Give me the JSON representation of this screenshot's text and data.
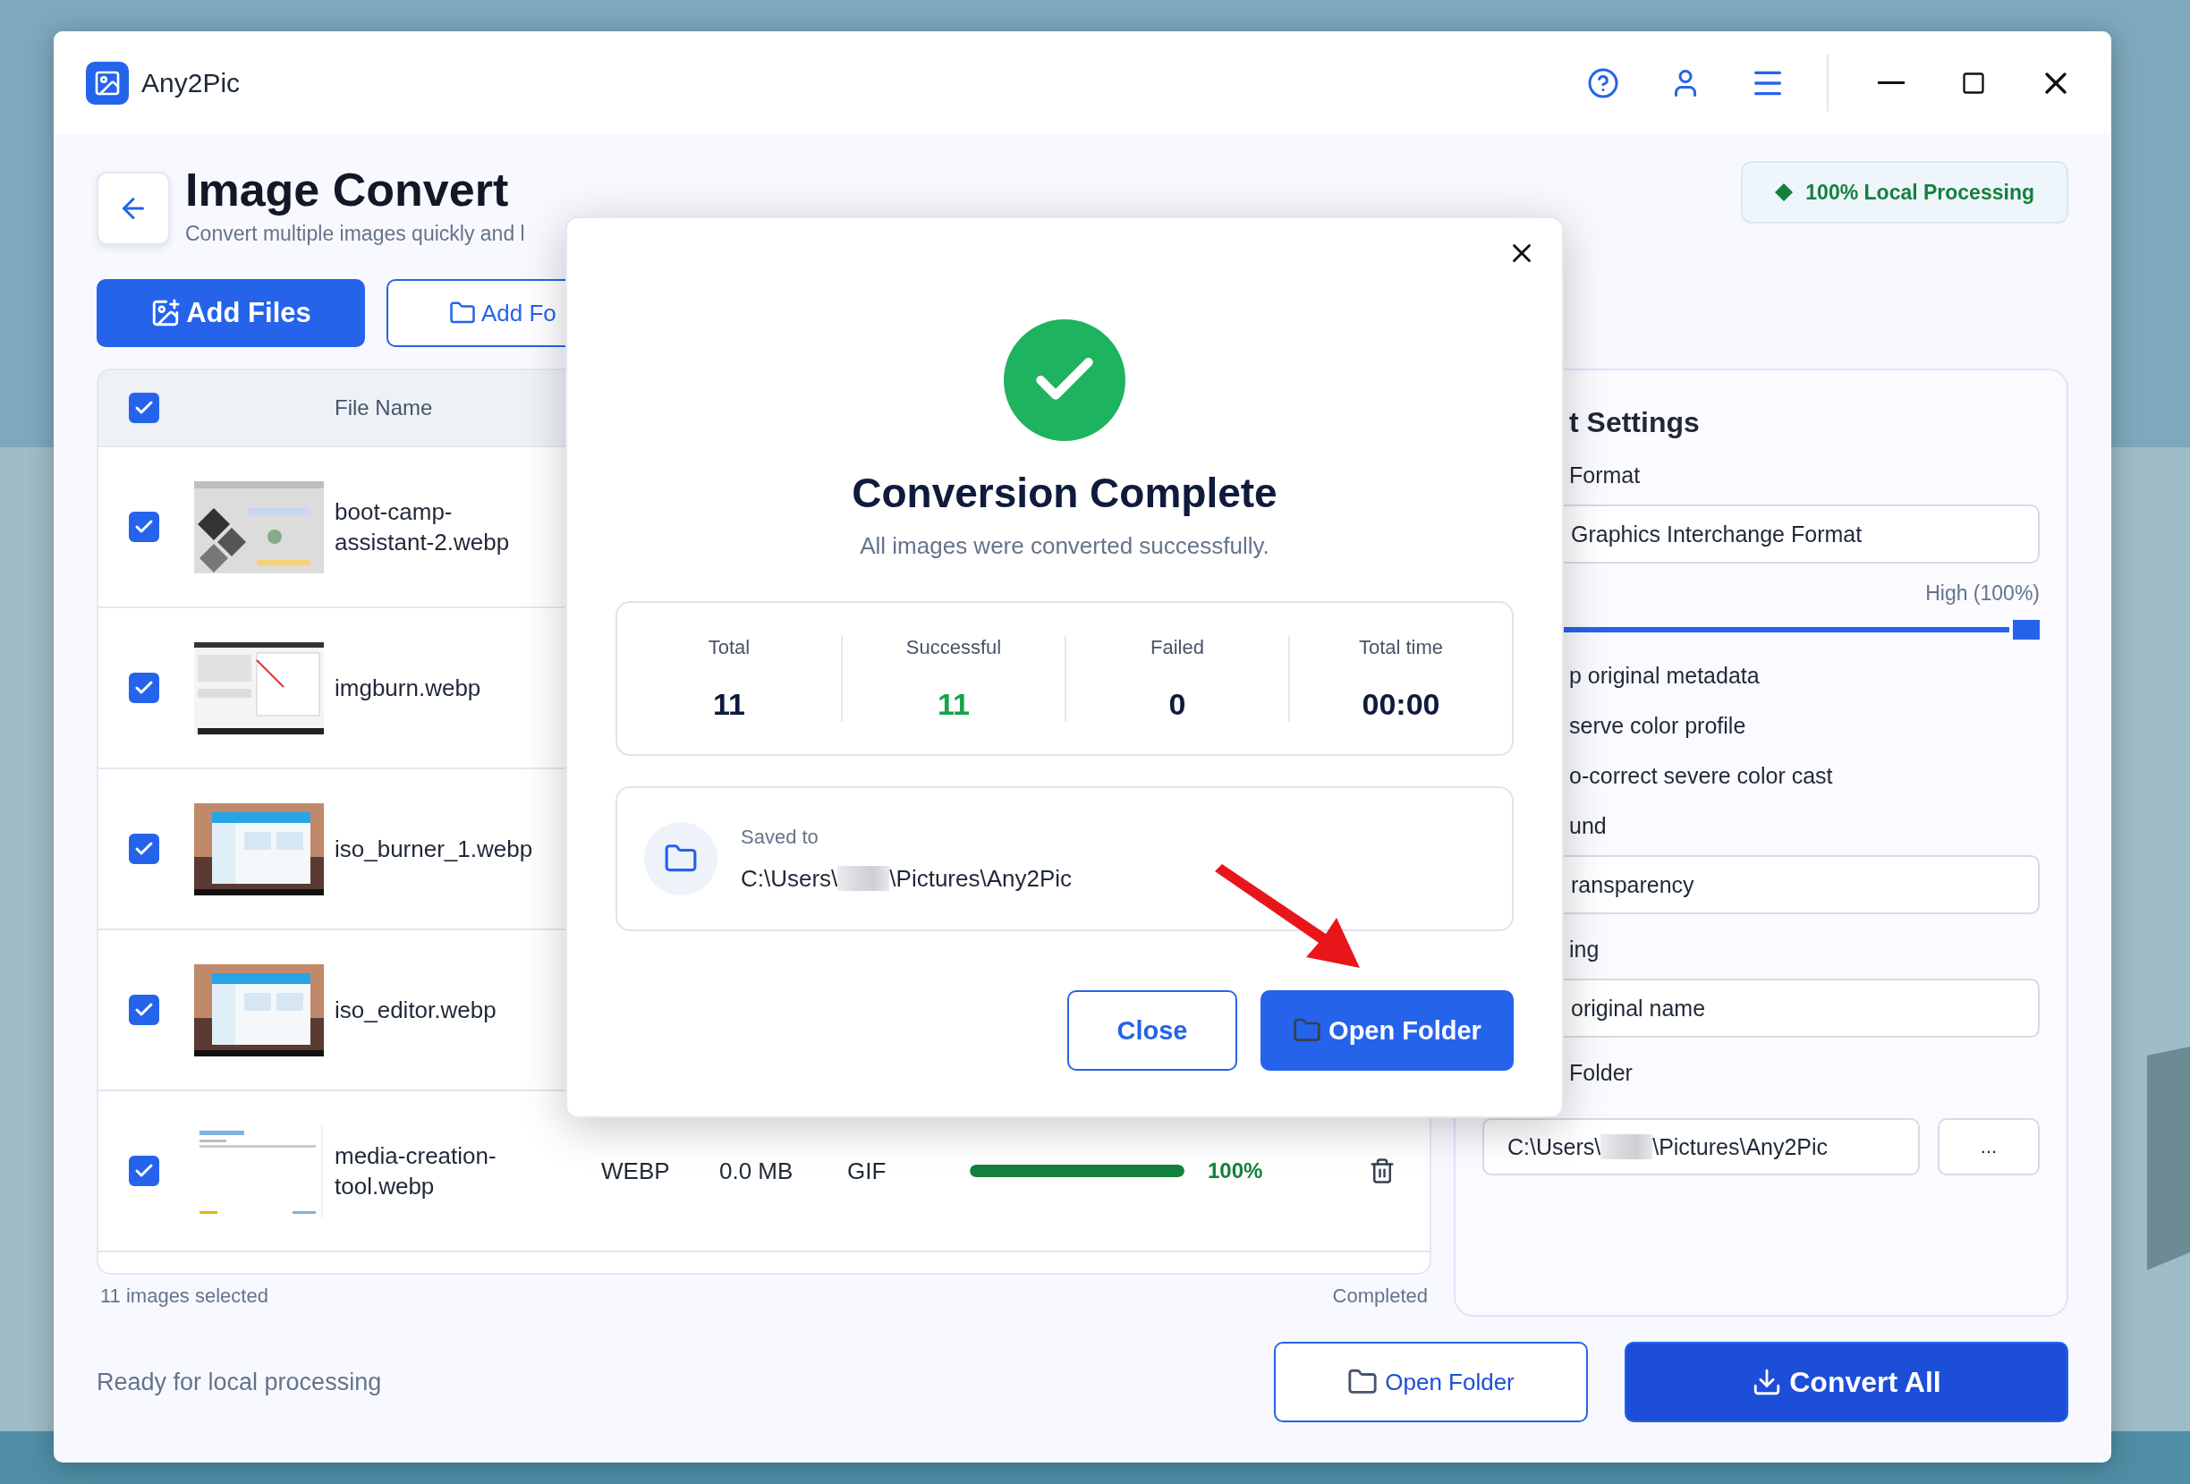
{
  "app": {
    "name": "Any2Pic"
  },
  "page": {
    "title": "Image Convert",
    "subtitle": "Convert multiple images quickly and l",
    "badge": "100% Local Processing"
  },
  "actions": [
    {
      "kind": "primary",
      "label": "Add Files"
    },
    {
      "kind": "secondary",
      "label": "Add Fo"
    }
  ],
  "table": {
    "select_all": {
      "checked": true
    },
    "header": "File Name",
    "files": [
      {
        "name": "boot-camp-assistant-2.webp",
        "checked": true
      },
      {
        "name": "imgburn.webp",
        "checked": true
      },
      {
        "name": "iso_burner_1.webp",
        "checked": true
      },
      {
        "name": "iso_editor.webp",
        "checked": true
      },
      {
        "name": "media-creation-tool.webp",
        "checked": true,
        "type": "WEBP",
        "size": "0.0 MB",
        "target": "GIF",
        "level": 1,
        "percent": "100%"
      }
    ]
  },
  "selection_count": "11 images selected",
  "status": "Completed",
  "settings": {
    "title": "t Settings",
    "items": [
      {
        "kind": "label",
        "text": "Format"
      },
      {
        "kind": "field",
        "value": "Graphics Interchange Format"
      },
      {
        "kind": "slider",
        "reading": "High (100%)",
        "level": 1
      },
      {
        "kind": "option",
        "text": "p original metadata"
      },
      {
        "kind": "option",
        "text": "serve color profile"
      },
      {
        "kind": "option",
        "text": "o-correct severe color cast"
      },
      {
        "kind": "label",
        "text": "und"
      },
      {
        "kind": "field",
        "value": "ransparency"
      },
      {
        "kind": "label",
        "text": "ing"
      },
      {
        "kind": "field",
        "value": "original name"
      },
      {
        "kind": "label",
        "text": "Folder"
      },
      {
        "kind": "folder",
        "path_start": "C:\\Users\\",
        "path_end": "\\Pictures\\Any2Pic",
        "browse": "..."
      }
    ]
  },
  "footer": {
    "ready": "Ready for local processing",
    "buttons": [
      {
        "kind": "secondary",
        "label": "Open Folder"
      },
      {
        "kind": "primary",
        "label": "Convert All"
      }
    ]
  },
  "modal": {
    "title": "Conversion Complete",
    "message": "All images were converted successfully.",
    "stats": [
      {
        "label": "Total",
        "value": "11",
        "color": "#0f1b3d"
      },
      {
        "label": "Successful",
        "value": "11",
        "color": "#16a34a"
      },
      {
        "label": "Failed",
        "value": "0",
        "color": "#0f1b3d"
      },
      {
        "label": "Total time",
        "value": "00:00",
        "color": "#0f1b3d"
      }
    ],
    "saved": {
      "label": "Saved to",
      "path_start": "C:\\Users\\",
      "path_end": "\\Pictures\\Any2Pic"
    },
    "buttons": [
      {
        "kind": "secondary",
        "label": "Close"
      },
      {
        "kind": "primary",
        "label": "Open Folder"
      }
    ]
  }
}
